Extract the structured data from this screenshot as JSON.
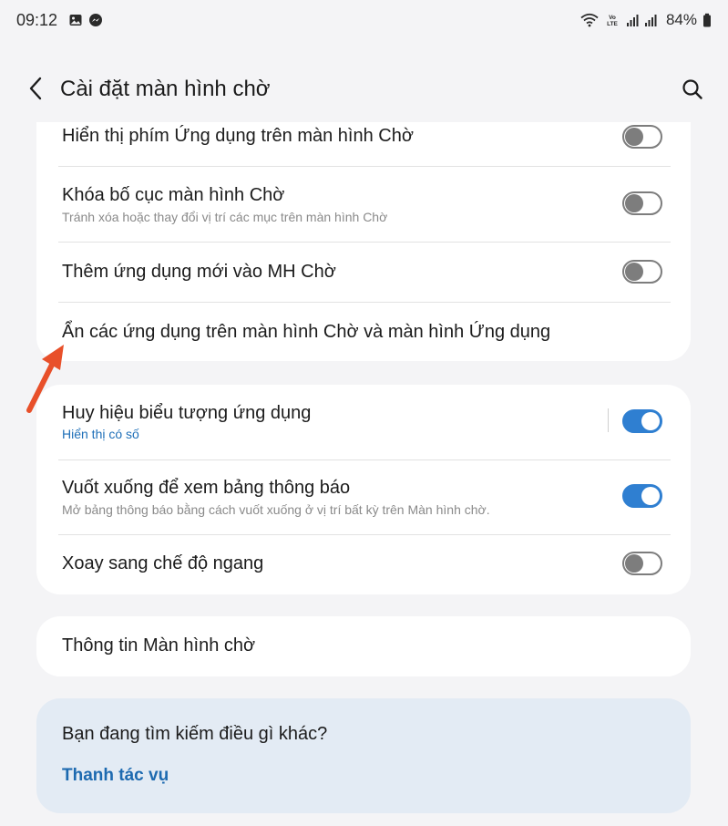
{
  "status_bar": {
    "time": "09:12",
    "battery": "84%",
    "icons": [
      "gallery-icon",
      "messenger-icon",
      "wifi-icon",
      "volte-icon",
      "signal-icon",
      "signal-icon",
      "battery-icon"
    ]
  },
  "header": {
    "title": "Cài đặt màn hình chờ",
    "back_icon": "chevron-left-icon",
    "search_icon": "search-icon"
  },
  "group1": {
    "rows": [
      {
        "title": "Hiển thị phím Ứng dụng trên màn hình Chờ",
        "toggle": "off"
      },
      {
        "title": "Khóa bố cục màn hình Chờ",
        "subtitle": "Tránh xóa hoặc thay đổi vị trí các mục trên màn hình Chờ",
        "toggle": "off"
      },
      {
        "title": "Thêm ứng dụng mới vào MH Chờ",
        "toggle": "off"
      },
      {
        "title": "Ẩn các ứng dụng trên màn hình Chờ và màn hình Ứng dụng"
      }
    ]
  },
  "group2": {
    "rows": [
      {
        "title": "Huy hiệu biểu tượng ứng dụng",
        "subtitle": "Hiển thị có số",
        "toggle": "on"
      },
      {
        "title": "Vuốt xuống để xem bảng thông báo",
        "subtitle": "Mở bảng thông báo bằng cách vuốt xuống ở vị trí bất kỳ trên Màn hình chờ.",
        "toggle": "on"
      },
      {
        "title": "Xoay sang chế độ ngang",
        "toggle": "off"
      }
    ]
  },
  "group3": {
    "title": "Thông tin Màn hình chờ"
  },
  "help": {
    "title": "Bạn đang tìm kiếm điều gì khác?",
    "link": "Thanh tác vụ"
  },
  "colors": {
    "background": "#f4f4f6",
    "card": "#ffffff",
    "accent": "#2f7fd1",
    "link": "#1d6ab0",
    "help_card": "#e3ebf4",
    "annotation_arrow": "#e8502a"
  }
}
